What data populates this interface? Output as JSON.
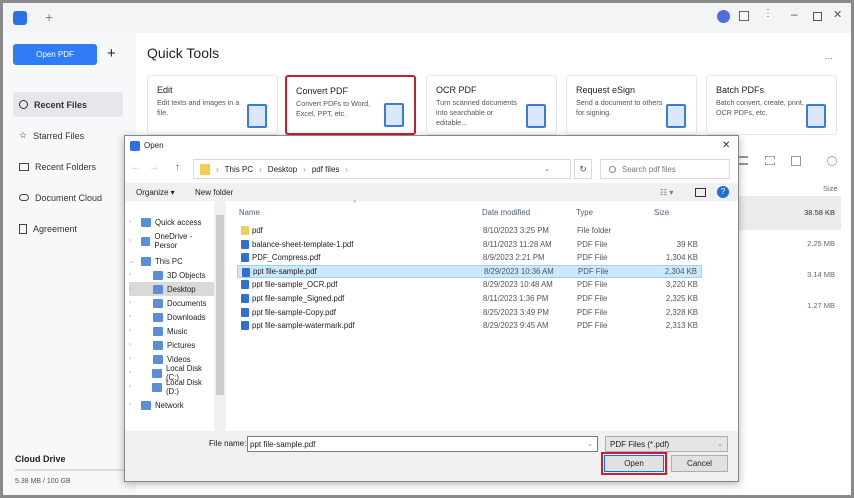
{
  "app": {
    "new_tab": "+",
    "open_pdf": "Open PDF",
    "add": "+"
  },
  "sidebar": {
    "items": [
      {
        "label": "Recent Files",
        "icon": "clock-icon"
      },
      {
        "label": "Starred Files",
        "icon": "star-icon"
      },
      {
        "label": "Recent Folders",
        "icon": "folder-icon"
      },
      {
        "label": "Document Cloud",
        "icon": "cloud-icon"
      },
      {
        "label": "Agreement",
        "icon": "document-icon"
      }
    ],
    "cloud_title": "Cloud Drive",
    "cloud_usage": "5.38 MB / 100 GB"
  },
  "main": {
    "title": "Quick Tools",
    "more": "...",
    "cards": [
      {
        "title": "Edit",
        "desc": "Edit texts and images in a file."
      },
      {
        "title": "Convert PDF",
        "desc": "Convert PDFs to Word, Excel, PPT, etc."
      },
      {
        "title": "OCR PDF",
        "desc": "Turn scanned documents into searchable or editable..."
      },
      {
        "title": "Request eSign",
        "desc": "Send a document to others for signing."
      },
      {
        "title": "Batch PDFs",
        "desc": "Batch convert, create, print, OCR PDFs, etc."
      }
    ],
    "size_header": "Size",
    "sizes": [
      "38.58 KB",
      "2.25 MB",
      "3.14 MB",
      "1.27 MB"
    ]
  },
  "dialog": {
    "title": "Open",
    "close": "✕",
    "path": [
      "This PC",
      "Desktop",
      "pdf files"
    ],
    "search_placeholder": "Search pdf files",
    "organize": "Organize ▾",
    "new_folder": "New folder",
    "columns": {
      "name": "Name",
      "date": "Date modified",
      "type": "Type",
      "size": "Size"
    },
    "nav": [
      {
        "label": "Quick access",
        "indent": 0
      },
      {
        "label": "OneDrive - Persor",
        "indent": 0
      },
      {
        "label": "This PC",
        "indent": 0
      },
      {
        "label": "3D Objects",
        "indent": 1
      },
      {
        "label": "Desktop",
        "indent": 1
      },
      {
        "label": "Documents",
        "indent": 1
      },
      {
        "label": "Downloads",
        "indent": 1
      },
      {
        "label": "Music",
        "indent": 1
      },
      {
        "label": "Pictures",
        "indent": 1
      },
      {
        "label": "Videos",
        "indent": 1
      },
      {
        "label": "Local Disk (C:)",
        "indent": 1
      },
      {
        "label": "Local Disk (D:)",
        "indent": 1
      },
      {
        "label": "Network",
        "indent": 0
      }
    ],
    "files": [
      {
        "name": "pdf",
        "date": "8/10/2023 3:25 PM",
        "type": "File folder",
        "size": ""
      },
      {
        "name": "balance-sheet-template-1.pdf",
        "date": "8/11/2023 11:28 AM",
        "type": "PDF File",
        "size": "39 KB"
      },
      {
        "name": "PDF_Compress.pdf",
        "date": "8/9/2023 2:21 PM",
        "type": "PDF File",
        "size": "1,304 KB"
      },
      {
        "name": "ppt file-sample.pdf",
        "date": "8/29/2023 10:36 AM",
        "type": "PDF File",
        "size": "2,304 KB"
      },
      {
        "name": "ppt file-sample_OCR.pdf",
        "date": "8/29/2023 10:48 AM",
        "type": "PDF File",
        "size": "3,220 KB"
      },
      {
        "name": "ppt file-sample_Signed.pdf",
        "date": "8/11/2023 1:36 PM",
        "type": "PDF File",
        "size": "2,325 KB"
      },
      {
        "name": "ppt file-sample-Copy.pdf",
        "date": "8/25/2023 3:49 PM",
        "type": "PDF File",
        "size": "2,328 KB"
      },
      {
        "name": "ppt file-sample-watermark.pdf",
        "date": "8/29/2023 9:45 AM",
        "type": "PDF File",
        "size": "2,313 KB"
      }
    ],
    "file_name_label": "File name:",
    "file_name_value": "ppt file-sample.pdf",
    "filter": "PDF Files (*.pdf)",
    "open": "Open",
    "cancel": "Cancel"
  },
  "colors": {
    "accent": "#2f7cf6",
    "highlight": "#c8202a"
  }
}
